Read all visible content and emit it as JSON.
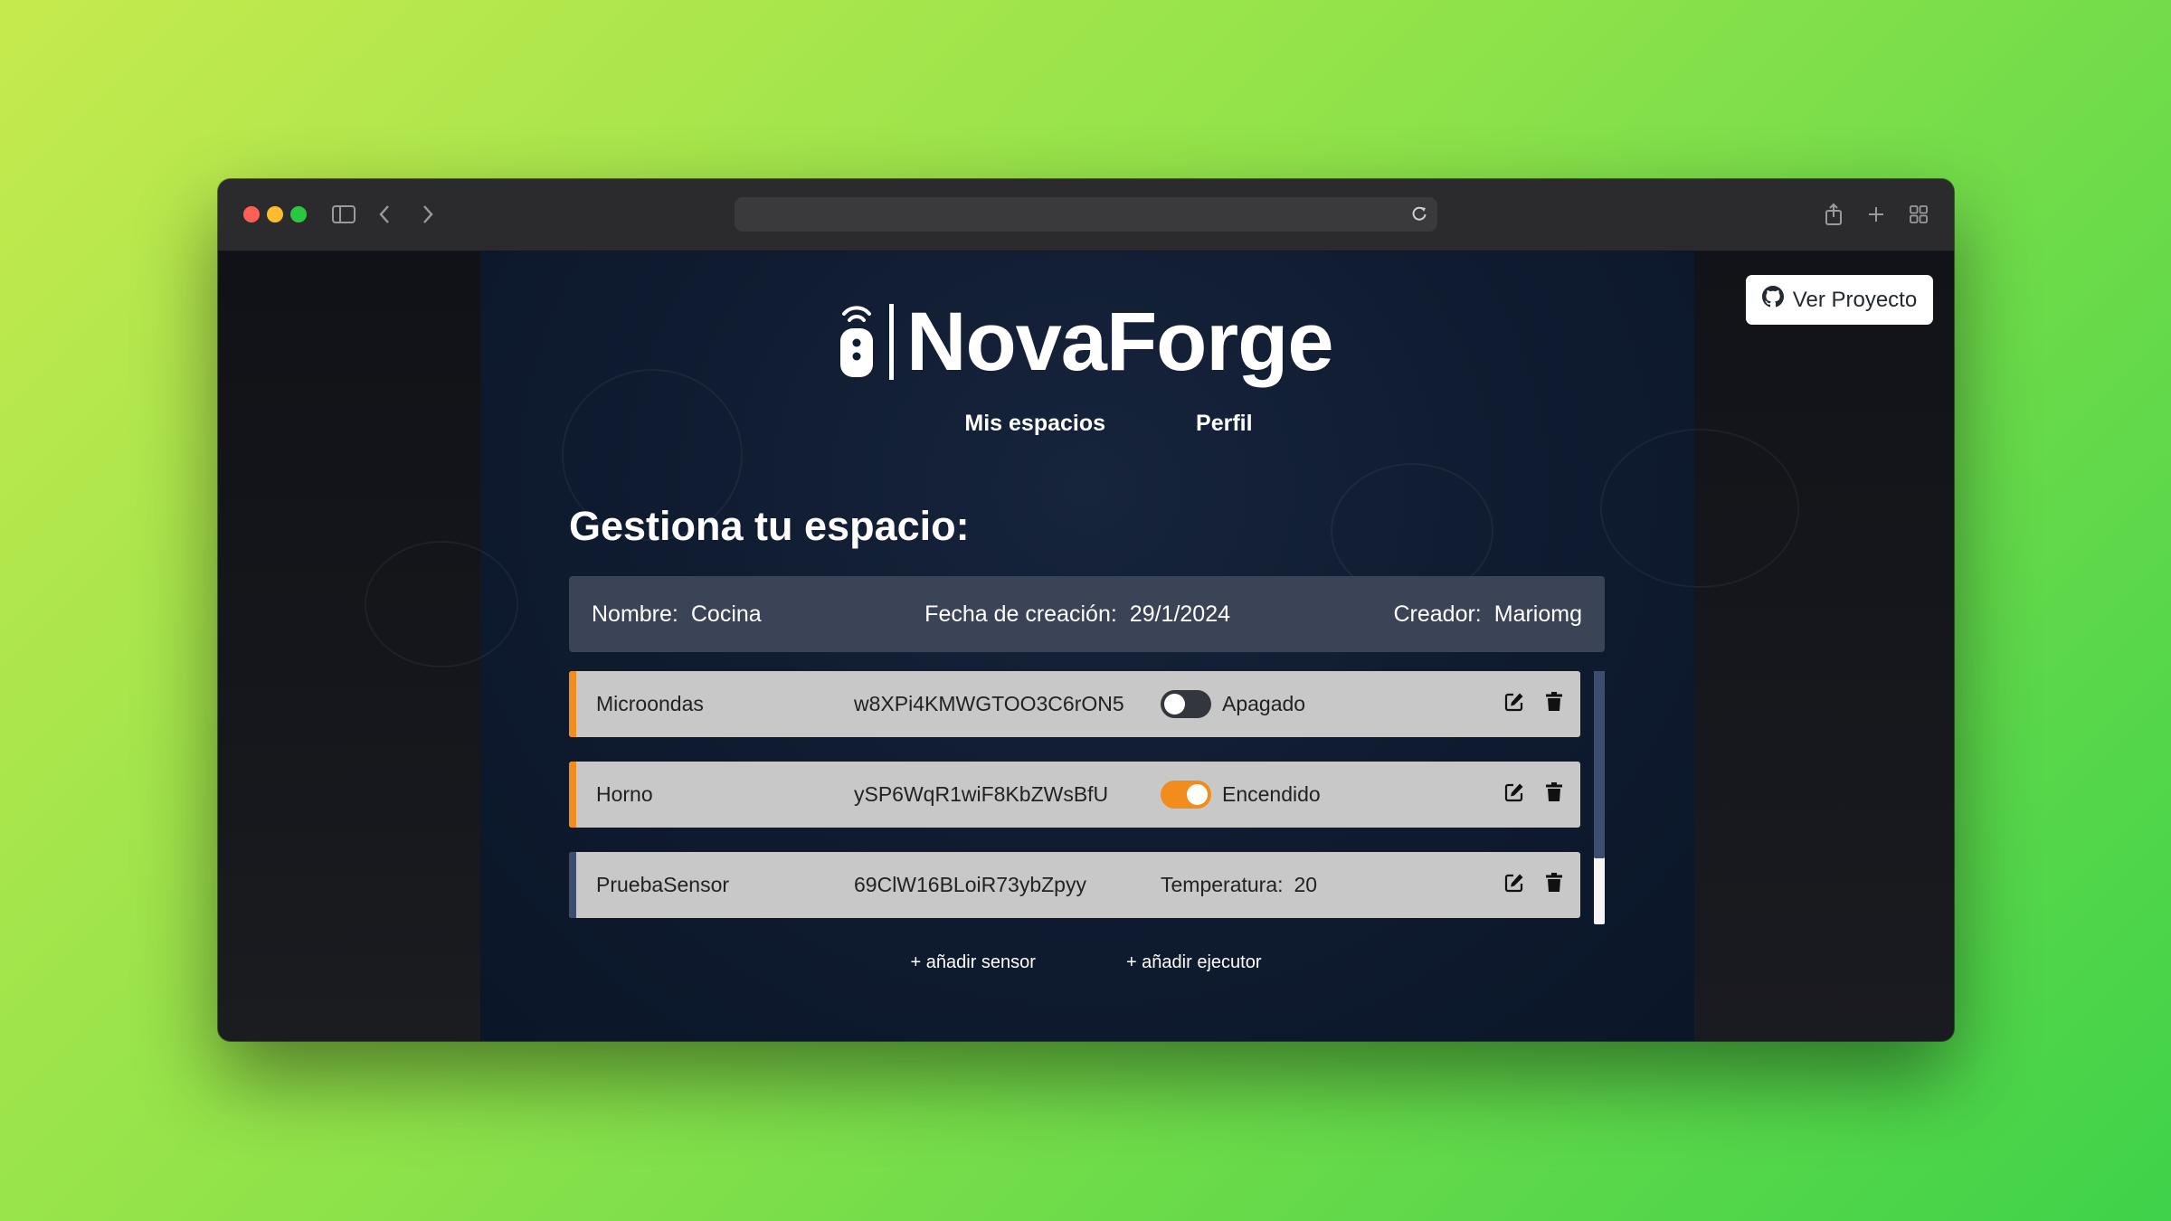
{
  "browser": {
    "address_text": ""
  },
  "header": {
    "github_button_label": "Ver Proyecto",
    "brand_name": "NovaForge"
  },
  "nav": {
    "items": [
      {
        "label": "Mis espacios"
      },
      {
        "label": "Perfil"
      }
    ]
  },
  "page": {
    "heading": "Gestiona tu espacio:"
  },
  "space": {
    "name_label": "Nombre:",
    "name_value": "Cocina",
    "date_label": "Fecha de creación:",
    "date_value": "29/1/2024",
    "creator_label": "Creador:",
    "creator_value": "Mariomg"
  },
  "devices": [
    {
      "name": "Microondas",
      "id": "w8XPi4KMWGTOO3C6rON5",
      "kind": "actuator",
      "state_label": "Apagado",
      "on": false,
      "stripe_color": "#f28c1c"
    },
    {
      "name": "Horno",
      "id": "ySP6WqR1wiF8KbZWsBfU",
      "kind": "actuator",
      "state_label": "Encendido",
      "on": true,
      "stripe_color": "#f28c1c"
    },
    {
      "name": "PruebaSensor",
      "id": "69ClW16BLoiR73ybZpyy",
      "kind": "sensor",
      "reading_label": "Temperatura:",
      "reading_value": "20",
      "stripe_color": "#3c4d6d"
    }
  ],
  "actions": {
    "add_sensor": "+ añadir sensor",
    "add_executor": "+ añadir ejecutor"
  },
  "colors": {
    "accent": "#f28c1c",
    "sensor_accent": "#3c4d6d",
    "panel": "#3b4456"
  }
}
